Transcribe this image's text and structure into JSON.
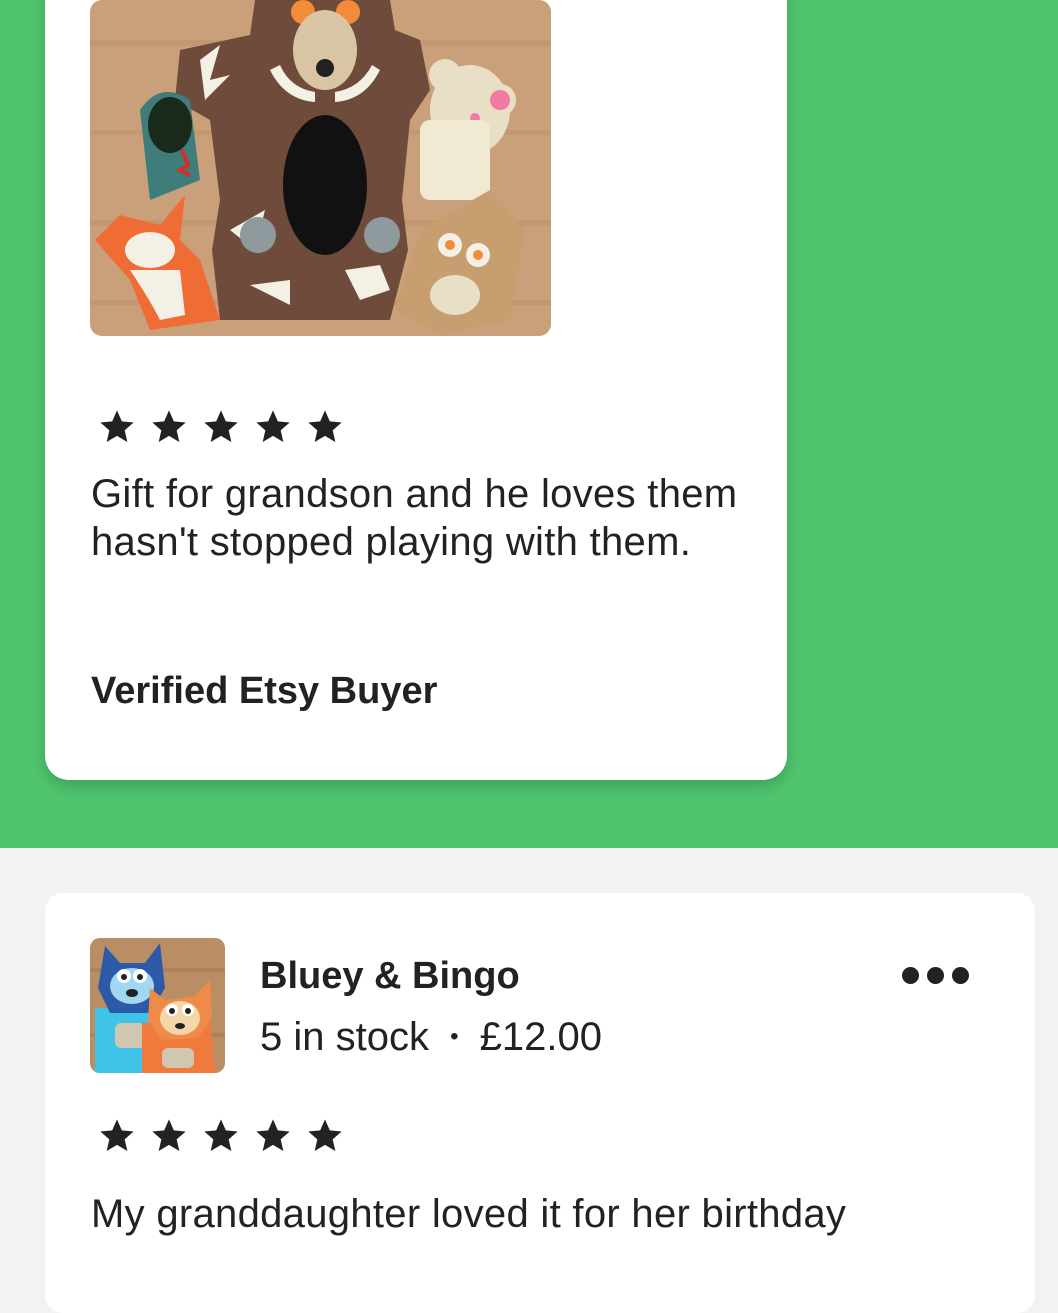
{
  "reviews": [
    {
      "rating": 5,
      "rating_label": "5 out of 5 stars",
      "photo_icon": "puppet-set-photo",
      "text": "Gift for grandson and he loves them hasn't stopped playing with them.",
      "reviewer": "Verified Etsy Buyer"
    },
    {
      "rating": 5,
      "rating_label": "5 out of 5 stars",
      "item": {
        "title": "Bluey & Bingo",
        "stock": "5 in stock",
        "separator": "•",
        "price": "£12.00",
        "thumb_icon": "bluey-bingo-puppet-thumbnail"
      },
      "more_icon": "more-options-icon",
      "text": "My granddaughter loved it for her birthday"
    }
  ],
  "colors": {
    "background_green": "#4fc46e",
    "page_background": "#f2f2f2",
    "card": "#ffffff",
    "text": "#222222",
    "star": "#222222"
  }
}
